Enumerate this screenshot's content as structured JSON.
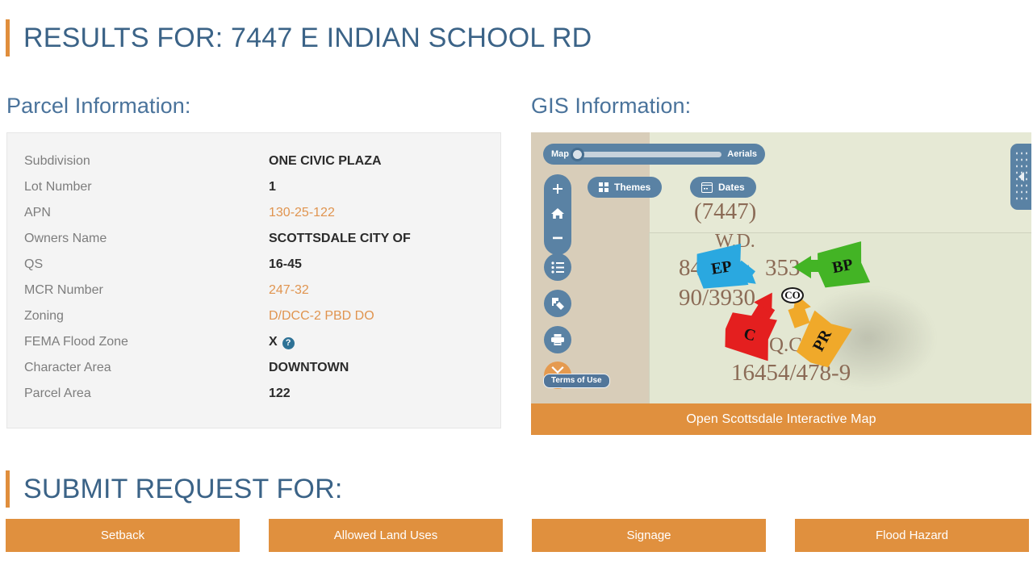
{
  "page": {
    "results_title": "RESULTS FOR: 7447 E INDIAN SCHOOL RD",
    "submit_title": "SUBMIT REQUEST FOR:"
  },
  "parcel": {
    "heading": "Parcel Information:",
    "rows": [
      {
        "label": "Subdivision",
        "value": "ONE CIVIC PLAZA",
        "style": "bold"
      },
      {
        "label": "Lot Number",
        "value": "1",
        "style": "bold"
      },
      {
        "label": "APN",
        "value": "130-25-122",
        "style": "link"
      },
      {
        "label": "Owners Name",
        "value": "SCOTTSDALE CITY OF",
        "style": "bold"
      },
      {
        "label": "QS",
        "value": "16-45",
        "style": "bold"
      },
      {
        "label": "MCR Number",
        "value": "247-32",
        "style": "link"
      },
      {
        "label": "Zoning",
        "value": "D/DCC-2 PBD DO",
        "style": "link"
      },
      {
        "label": "FEMA Flood Zone",
        "value": "X",
        "style": "bold",
        "help": "?"
      },
      {
        "label": "Character Area",
        "value": "DOWNTOWN",
        "style": "bold"
      },
      {
        "label": "Parcel Area",
        "value": "122",
        "style": "bold"
      }
    ]
  },
  "gis": {
    "heading": "GIS Information:",
    "slider": {
      "left_label": "Map",
      "right_label": "Aerials"
    },
    "themes_label": "Themes",
    "dates_label": "Dates",
    "terms_label": "Terms of Use",
    "open_map_label": "Open Scottsdale Interactive Map",
    "map_labels": {
      "address_number": "(7447)",
      "wd": "W.D.",
      "book_left": "84",
      "book_right": "353",
      "doc_ref": "90/3930",
      "qc": "Q.C.",
      "qc_ref": "16454/478-9"
    },
    "marker_label": "CO",
    "callouts": [
      {
        "code": "EP",
        "color": "#2aa8e0"
      },
      {
        "code": "BP",
        "color": "#43b425"
      },
      {
        "code": "C",
        "color": "#e41f1f"
      },
      {
        "code": "PR",
        "color": "#f0a92a"
      }
    ]
  },
  "request_buttons": [
    {
      "label": "Setback"
    },
    {
      "label": "Allowed Land Uses"
    },
    {
      "label": "Signage"
    },
    {
      "label": "Flood Hazard"
    }
  ],
  "colors": {
    "accent_orange": "#e0903e",
    "title_blue": "#3b6387",
    "heading_blue": "#4a739b",
    "link_orange": "#e0944f",
    "map_chrome_blue": "#5a82a4",
    "map_label_brown": "#8b6b56"
  }
}
